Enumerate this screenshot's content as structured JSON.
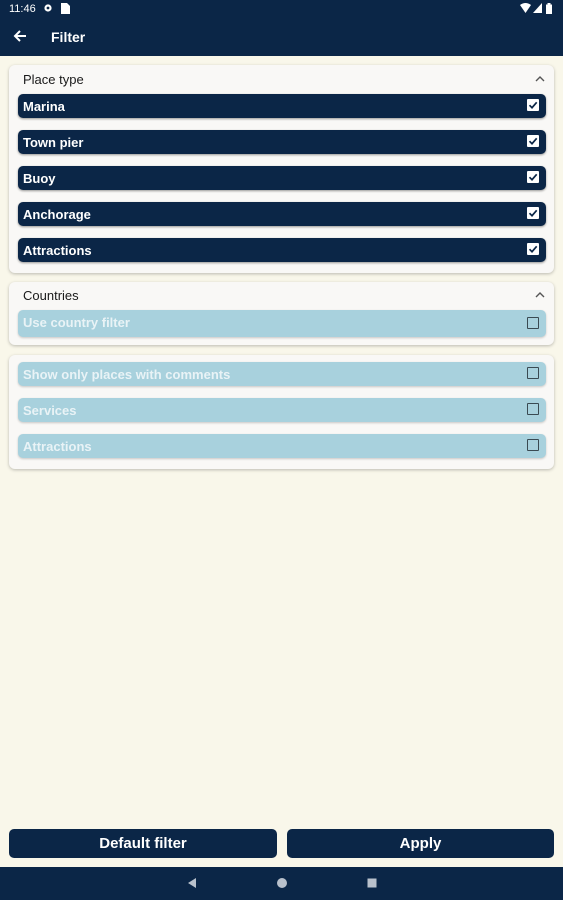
{
  "status_bar": {
    "time": "11:46"
  },
  "app_bar": {
    "title": "Filter",
    "back_icon": "arrow-left-icon"
  },
  "place_type": {
    "title": "Place type",
    "items": [
      {
        "label": "Marina",
        "checked": true
      },
      {
        "label": "Town pier",
        "checked": true
      },
      {
        "label": "Buoy",
        "checked": true
      },
      {
        "label": "Anchorage",
        "checked": true
      },
      {
        "label": "Attractions",
        "checked": true
      }
    ]
  },
  "countries": {
    "title": "Countries",
    "items": [
      {
        "label": "Use country filter",
        "checked": false
      }
    ]
  },
  "other": {
    "items": [
      {
        "label": "Show only places with comments",
        "checked": false
      },
      {
        "label": "Services",
        "checked": false
      },
      {
        "label": "Attractions",
        "checked": false
      }
    ]
  },
  "buttons": {
    "default_filter": "Default filter",
    "apply": "Apply"
  },
  "colors": {
    "primary": "#0b2647",
    "disabled_row": "#a8d1dd",
    "background": "#f9f7ea"
  }
}
